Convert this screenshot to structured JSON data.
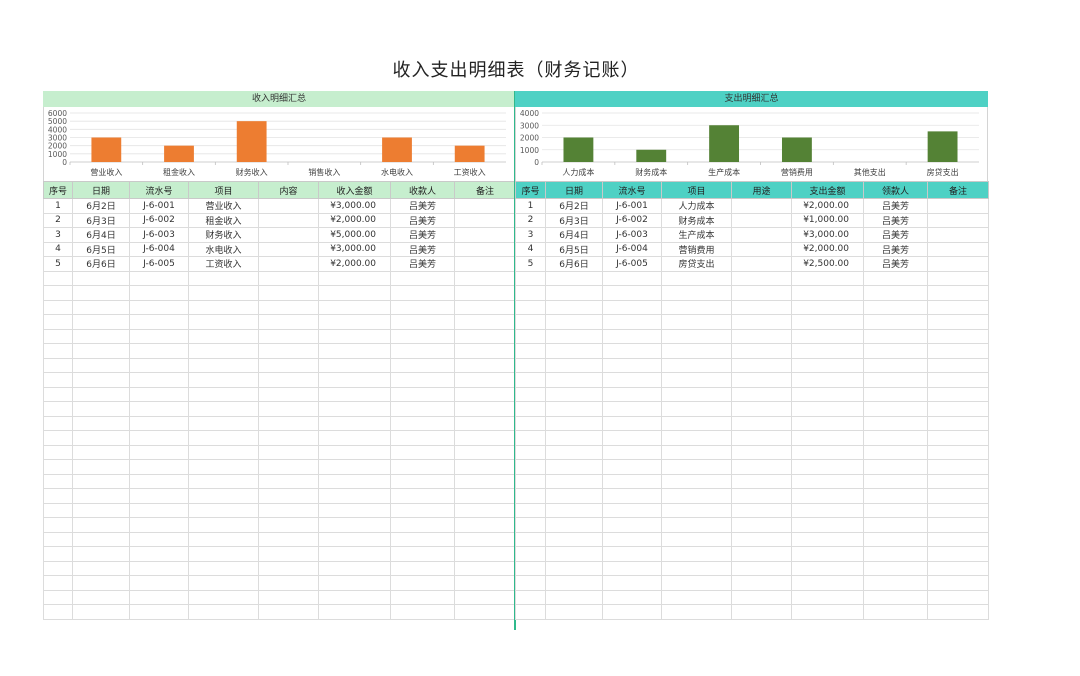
{
  "title": "收入支出明细表（财务记账）",
  "colors": {
    "income_accent": "#c6eece",
    "expense_accent": "#4ed1c4",
    "income_bar": "#ed7d31",
    "expense_bar": "#548235",
    "divider": "#2fb98c"
  },
  "income": {
    "heading": "收入明细汇总",
    "columns": [
      "序号",
      "日期",
      "流水号",
      "项目",
      "内容",
      "收入金额",
      "收款人",
      "备注"
    ],
    "rows": [
      [
        "1",
        "6月2日",
        "J-6-001",
        "营业收入",
        "",
        "¥3,000.00",
        "吕美芳",
        ""
      ],
      [
        "2",
        "6月3日",
        "J-6-002",
        "租金收入",
        "",
        "¥2,000.00",
        "吕美芳",
        ""
      ],
      [
        "3",
        "6月4日",
        "J-6-003",
        "财务收入",
        "",
        "¥5,000.00",
        "吕美芳",
        ""
      ],
      [
        "4",
        "6月5日",
        "J-6-004",
        "水电收入",
        "",
        "¥3,000.00",
        "吕美芳",
        ""
      ],
      [
        "5",
        "6月6日",
        "J-6-005",
        "工资收入",
        "",
        "¥2,000.00",
        "吕美芳",
        ""
      ]
    ]
  },
  "expense": {
    "heading": "支出明细汇总",
    "columns": [
      "序号",
      "日期",
      "流水号",
      "项目",
      "用途",
      "支出金额",
      "领款人",
      "备注"
    ],
    "rows": [
      [
        "1",
        "6月2日",
        "J-6-001",
        "人力成本",
        "",
        "¥2,000.00",
        "吕美芳",
        ""
      ],
      [
        "2",
        "6月3日",
        "J-6-002",
        "财务成本",
        "",
        "¥1,000.00",
        "吕美芳",
        ""
      ],
      [
        "3",
        "6月4日",
        "J-6-003",
        "生产成本",
        "",
        "¥3,000.00",
        "吕美芳",
        ""
      ],
      [
        "4",
        "6月5日",
        "J-6-004",
        "营销费用",
        "",
        "¥2,000.00",
        "吕美芳",
        ""
      ],
      [
        "5",
        "6月6日",
        "J-6-005",
        "房贷支出",
        "",
        "¥2,500.00",
        "吕美芳",
        ""
      ]
    ]
  },
  "chart_data": [
    {
      "type": "bar",
      "categories": [
        "营业收入",
        "租金收入",
        "财务收入",
        "销售收入",
        "水电收入",
        "工资收入"
      ],
      "values": [
        3000,
        2000,
        5000,
        0,
        3000,
        2000
      ],
      "ylim": [
        0,
        6000
      ],
      "yticks": [
        "0",
        "1000",
        "2000",
        "3000",
        "4000",
        "5000",
        "6000"
      ],
      "grid": true,
      "color": "#ed7d31"
    },
    {
      "type": "bar",
      "categories": [
        "人力成本",
        "财务成本",
        "生产成本",
        "营销费用",
        "其他支出",
        "房贷支出"
      ],
      "values": [
        2000,
        1000,
        3000,
        2000,
        0,
        2500
      ],
      "ylim": [
        0,
        4000
      ],
      "yticks": [
        "0",
        "1000",
        "2000",
        "3000",
        "4000"
      ],
      "grid": true,
      "color": "#548235"
    }
  ]
}
